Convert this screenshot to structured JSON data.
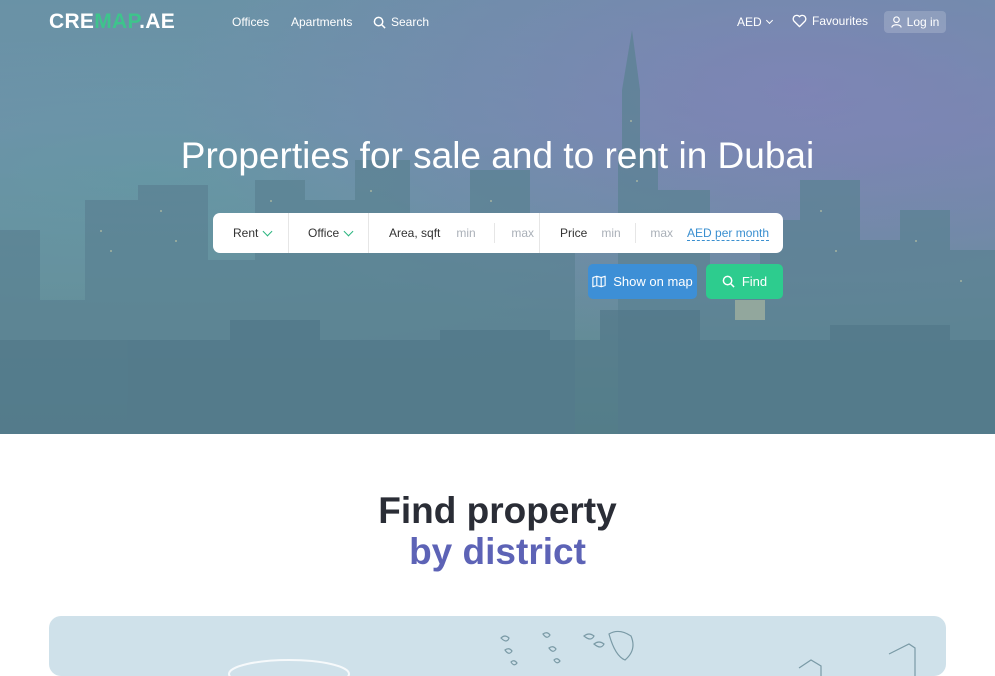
{
  "header": {
    "logo_left": "CRE",
    "logo_accent": "MAP",
    "logo_right": ".AE",
    "nav": [
      {
        "label": "Offices"
      },
      {
        "label": "Apartments"
      },
      {
        "label": "Search",
        "icon": "search-icon"
      }
    ],
    "currency": "AED",
    "favourites": "Favourites",
    "login": "Log in"
  },
  "hero": {
    "title": "Properties for sale and to rent in Dubai"
  },
  "search": {
    "deal_type": "Rent",
    "property_type": "Office",
    "area_label": "Area, sqft",
    "area_min_placeholder": "min",
    "area_max_placeholder": "max",
    "price_label": "Price",
    "price_min_placeholder": "min",
    "price_max_placeholder": "max",
    "price_unit": "AED per month"
  },
  "actions": {
    "show_on_map": "Show on map",
    "find": "Find"
  },
  "district_section": {
    "title": "Find property",
    "subtitle": "by district"
  },
  "colors": {
    "accent_green": "#2dcc8e",
    "accent_blue": "#3d8fd6",
    "subtitle_purple": "#5d63b6"
  }
}
